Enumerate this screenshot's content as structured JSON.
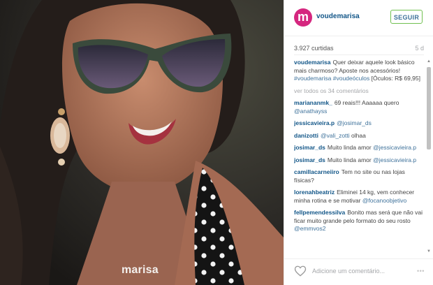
{
  "post": {
    "watermark": "marisa",
    "account": {
      "initial": "m",
      "username": "voudemarisa",
      "follow_label": "SEGUIR",
      "brand_color": "#d5277f"
    },
    "likes_text": "3.927 curtidas",
    "age_text": "5 d",
    "caption": {
      "user": "voudemarisa",
      "text_before": "Quer deixar aquele look básico mais charmoso? Aposte nos acessórios!",
      "hashtags": "#voudemarisa #voudeóculos",
      "text_after": "[Óculos: R$ 69,95]"
    },
    "view_all_comments": "ver todos os 34 comentários",
    "comments": [
      {
        "user": "mariananmk_",
        "text": "69 reais!!! Aaaaaa quero",
        "mention": "@anathayss"
      },
      {
        "user": "jessicavieira.p",
        "text": "",
        "mention": "@josimar_ds"
      },
      {
        "user": "danizotti",
        "text": "olhaa",
        "mention": "@vali_zotti"
      },
      {
        "user": "josimar_ds",
        "text": "Muito linda amor",
        "mention": "@jessicavieira.p"
      },
      {
        "user": "josimar_ds",
        "text": "Muito linda amor",
        "mention": "@jessicavieira.p"
      },
      {
        "user": "camillacarneiiro",
        "text": "Tem no site ou nas lojas físicas?",
        "mention": ""
      },
      {
        "user": "lorenahbeatriz",
        "text": "Eliminei 14 kg, vem conhecer minha rotina e se motivar",
        "mention": "@focanoobjetivo"
      },
      {
        "user": "fellpemendessilva",
        "text": "Bonito mas será que não vai ficar muito grande pelo formato do seu rosto",
        "mention": "@emmvos2"
      }
    ],
    "add_comment_placeholder": "Adicione um comentário...",
    "more_label": "•••"
  }
}
